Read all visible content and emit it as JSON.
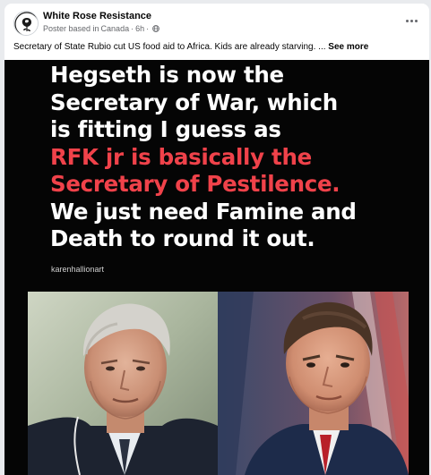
{
  "post": {
    "page_name": "White Rose Resistance",
    "meta": {
      "label": "Poster based in",
      "location": "Canada",
      "separator": "·",
      "time": "6h",
      "separator2": "·"
    },
    "caption": "Secretary of State Rubio cut US food aid to Africa. Kids are already starving. ...",
    "see_more": "See more",
    "more_icon": "more-options-icon",
    "privacy_icon": "globe-icon"
  },
  "image": {
    "lines": [
      "Hegseth is now the",
      "Secretary of War, which",
      "is fitting I guess as",
      "RFK jr is basically the",
      "Secretary of Pestilence.",
      "We just need Famine and",
      "Death to round it out."
    ],
    "highlight_color": "#f0424a",
    "text_color": "#ffffff",
    "credit": "karenhallionart"
  }
}
